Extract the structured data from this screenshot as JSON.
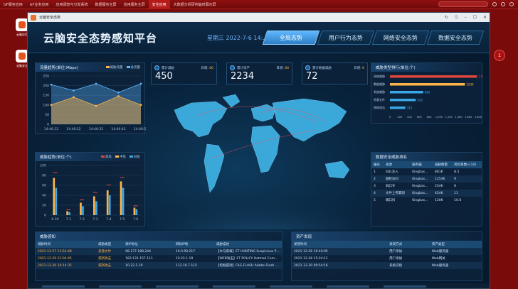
{
  "taskbar": {
    "tabs": [
      {
        "label": "GF服务应用",
        "active": false
      },
      {
        "label": "GF业务应用",
        "active": false
      },
      {
        "label": "应用调查与分发系统",
        "active": false
      },
      {
        "label": "数据服务主屏",
        "active": false
      },
      {
        "label": "应用服务主屏",
        "active": false
      },
      {
        "label": "安全应用",
        "active": true
      },
      {
        "label": "大数据分析研判临时展示屏",
        "active": false
      }
    ]
  },
  "desktop": {
    "icons": [
      {
        "label": "云脑应用"
      },
      {
        "label": "云脑安全"
      }
    ],
    "notify_badge": "1"
  },
  "window": {
    "title": "云脑安全态势"
  },
  "dashboard": {
    "title": "云脑安全态势感知平台",
    "datetime": "星期三 2022-7-6 14:...",
    "tabs": [
      "全局态势",
      "用户行为态势",
      "网络安全态势",
      "数据安全态势"
    ],
    "traffic": {
      "title": "流量趋势(单位:Mbps)",
      "legend": [
        "威胁流量",
        "总流量"
      ]
    },
    "threat_trend": {
      "title": "威胁趋势(单位:个)",
      "legend": [
        "高危",
        "中危",
        "低危"
      ]
    },
    "stats": [
      {
        "label": "累计威胁",
        "today_label": "日增:",
        "today": "80",
        "value": "450"
      },
      {
        "label": "累计资产",
        "today_label": "日增:",
        "today": "80",
        "value": "2234"
      },
      {
        "label": "累计数据威胁",
        "today_label": "日增:",
        "today": "6",
        "value": "72"
      }
    ],
    "threat_rank": {
      "title": "威胁类型排行(单位:个)"
    },
    "data_rank": {
      "title": "数据安全威胁排名",
      "headers": [
        "编号",
        "表源",
        "服务器",
        "威胁数量",
        "风险系数(<10)"
      ],
      "rows": [
        [
          "1",
          "SQL注入",
          "Kingbas...",
          "861K",
          "8.5"
        ],
        [
          "2",
          "越权访问",
          "Kingbas...",
          "1254K",
          "9"
        ],
        [
          "3",
          "弱口令",
          "Kingbas...",
          "254K",
          "8"
        ],
        [
          "4",
          "文件上传漏洞",
          "Kingbas...",
          "454K",
          "11"
        ],
        [
          "5",
          "端口扫",
          "Kingbas...",
          "120K",
          "10.6"
        ]
      ]
    },
    "threat_perception": {
      "title": "威胁感知",
      "headers": [
        "威胁时间",
        "威胁类型",
        "源IP地址",
        "目标IP地",
        "威胁描述"
      ],
      "rows": [
        [
          "2021-12-27 11:54:48",
          "恶意文件",
          "98.177.188.244",
          "10.0.90.217",
          "【木马病毒】ET HUNTING Suspicious POST HUNT..."
        ],
        [
          "2021-12-29 21:04:45",
          "漏洞攻击",
          "183.131.157.111",
          "10.22.1.19",
          "【WEB攻击】ET POLICY Hotmail Compone..."
        ],
        [
          "2021-12-30 10:14:35",
          "漏洞攻击",
          "10.22.1.19",
          "112.16.7.115",
          "【挖掘漏洞】FILE-FLASH Adobe Flash Playe..."
        ]
      ]
    },
    "asset_discovery": {
      "title": "资产发现",
      "headers": [
        "发现时间",
        "发现方式",
        "资产类型"
      ],
      "rows": [
        [
          "2021-12-26 16:40:05",
          "用户添加",
          "Web服务器"
        ],
        [
          "2021-12-28 15:24:11",
          "用户添加",
          "Web网关"
        ],
        [
          "2021-12-30 09:54:16",
          "系统识别",
          "Web服务器"
        ]
      ]
    }
  },
  "chart_data": [
    {
      "type": "area",
      "title": "流量趋势(单位:Mbps)",
      "x": [
        "14:46:12",
        "14:46:22",
        "14:46:32",
        "14:46:42",
        "14:46:52"
      ],
      "ylim": [
        0,
        250
      ],
      "yticks": [
        0,
        50,
        100,
        150,
        200,
        250
      ],
      "series": [
        {
          "name": "威胁流量",
          "values": [
            100,
            140,
            95,
            145,
            100
          ]
        },
        {
          "name": "总流量",
          "values": [
            205,
            175,
            210,
            165,
            210
          ]
        }
      ],
      "grid": true,
      "legend": "top-right"
    },
    {
      "type": "bar",
      "title": "威胁趋势(单位:个)",
      "categories": [
        "6-30",
        "7-1",
        "7-2",
        "7-3",
        "7-4",
        "7-5",
        "7-6"
      ],
      "ylim": [
        0,
        100
      ],
      "yticks": [
        0,
        20,
        40,
        60,
        80,
        100
      ],
      "series": [
        {
          "name": "高危",
          "values": [
            85,
            10,
            30,
            45,
            60,
            75,
            18
          ]
        },
        {
          "name": "中危",
          "values": [
            75,
            8,
            25,
            38,
            50,
            68,
            15
          ]
        },
        {
          "name": "低危",
          "values": [
            55,
            6,
            18,
            28,
            40,
            55,
            12
          ]
        }
      ],
      "legend": "top-right"
    },
    {
      "type": "bar",
      "title": "威胁类型排行(单位:个)",
      "categories": [
        "网络威胁",
        "数据威胁",
        "系统威胁",
        "恶意文件",
        "网络攻击"
      ],
      "values": [
        1777,
        1530,
        680,
        526,
        315
      ],
      "xticks": [
        0,
        200,
        400,
        600,
        800,
        1000,
        1200,
        1400,
        1600,
        1800
      ],
      "xlim": [
        0,
        1800
      ]
    }
  ],
  "colors": {
    "accent": "#5fb7ff",
    "high": "#e0453a",
    "mid": "#ffb44a",
    "low": "#3aa8e8"
  }
}
